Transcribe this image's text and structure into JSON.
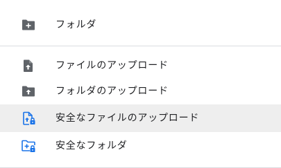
{
  "menu": {
    "items": [
      {
        "label": "フォルダ",
        "icon": "new-folder-icon"
      },
      {
        "label": "ファイルのアップロード",
        "icon": "file-upload-icon"
      },
      {
        "label": "フォルダのアップロード",
        "icon": "folder-upload-icon"
      },
      {
        "label": "安全なファイルのアップロード",
        "icon": "secure-file-upload-icon",
        "highlighted": true
      },
      {
        "label": "安全なフォルダ",
        "icon": "secure-folder-icon"
      }
    ]
  },
  "colors": {
    "icon_gray": "#5f6368",
    "secure_blue": "#1a73e8",
    "highlight_bg": "#eeeeee",
    "divider": "#dadce0"
  }
}
